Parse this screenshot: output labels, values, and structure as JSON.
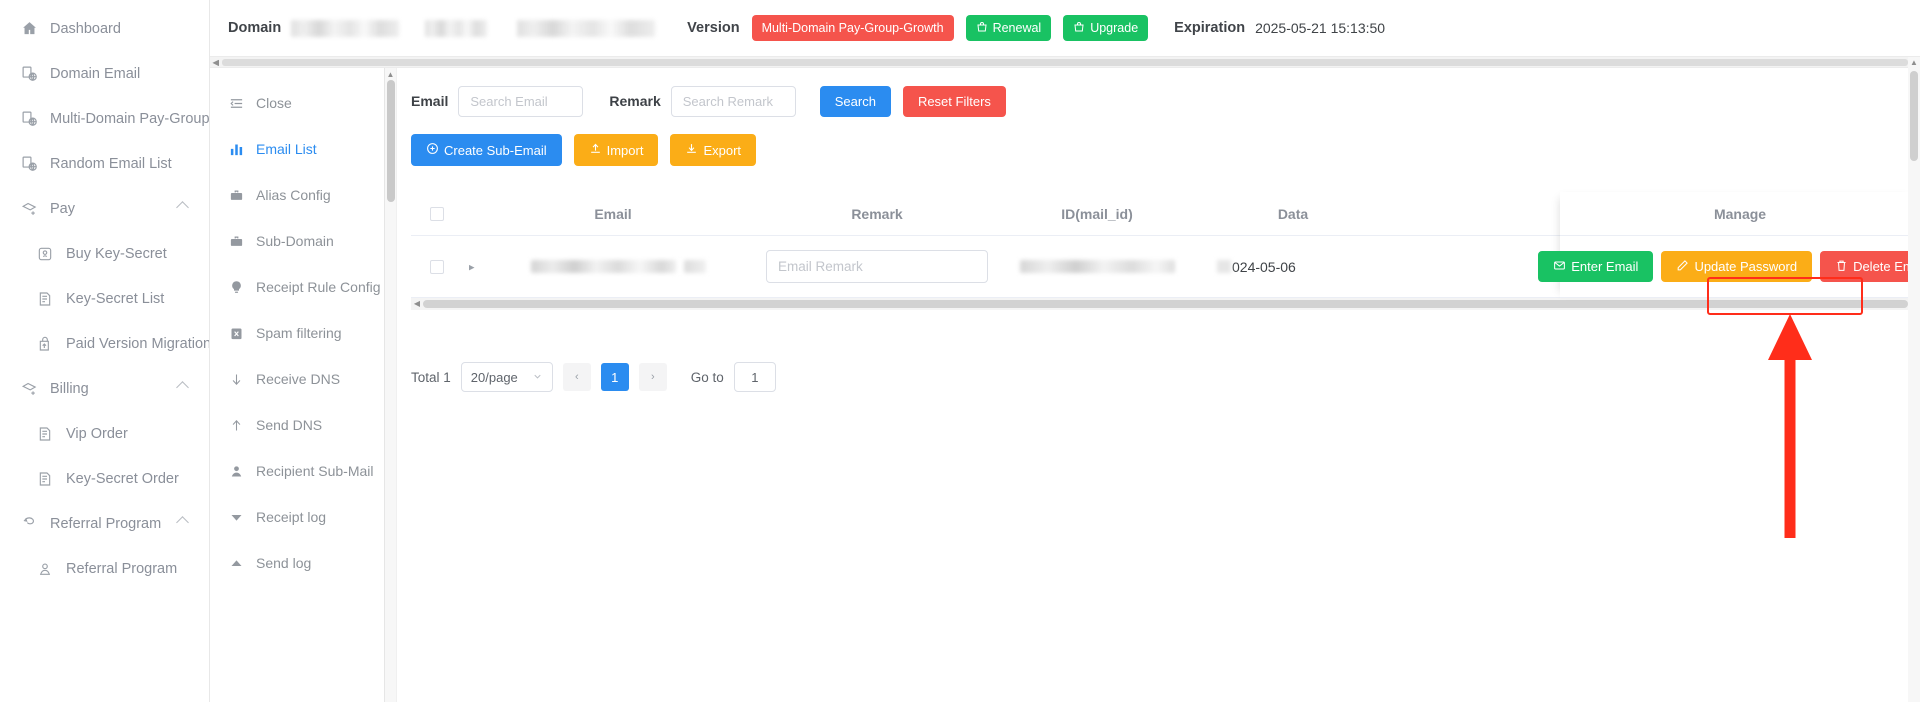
{
  "sidebar": {
    "items": [
      {
        "label": "Dashboard",
        "icon": "home-icon",
        "level": 0,
        "caret": false
      },
      {
        "label": "Domain Email",
        "icon": "domain-email-icon",
        "level": 0,
        "caret": false
      },
      {
        "label": "Multi-Domain Pay-Group",
        "icon": "domain-email-icon",
        "level": 0,
        "caret": false
      },
      {
        "label": "Random Email List",
        "icon": "domain-email-icon",
        "level": 0,
        "caret": false
      },
      {
        "label": "Pay",
        "icon": "pay-icon",
        "level": 0,
        "caret": true
      },
      {
        "label": "Buy Key-Secret",
        "icon": "key-buy-icon",
        "level": 1,
        "caret": false
      },
      {
        "label": "Key-Secret List",
        "icon": "list-icon",
        "level": 1,
        "caret": false
      },
      {
        "label": "Paid Version Migration",
        "icon": "migration-icon",
        "level": 1,
        "caret": false
      },
      {
        "label": "Billing",
        "icon": "pay-icon",
        "level": 0,
        "caret": true
      },
      {
        "label": "Vip Order",
        "icon": "list-icon",
        "level": 1,
        "caret": false
      },
      {
        "label": "Key-Secret Order",
        "icon": "list-icon",
        "level": 1,
        "caret": false
      },
      {
        "label": "Referral Program",
        "icon": "referral-icon",
        "level": 0,
        "caret": true
      },
      {
        "label": "Referral Program",
        "icon": "referral-person-icon",
        "level": 1,
        "caret": false
      }
    ]
  },
  "header": {
    "domain_label": "Domain",
    "version_label": "Version",
    "version_value": "Multi-Domain Pay-Group-Growth",
    "renewal_label": "Renewal",
    "upgrade_label": "Upgrade",
    "expiration_label": "Expiration",
    "expiration_value": "2025-05-21 15:13:50",
    "accent_red": "#f5544c",
    "accent_green": "#19c263"
  },
  "submenu": {
    "items": [
      {
        "label": "Close",
        "icon": "collapse-icon",
        "active": false
      },
      {
        "label": "Email List",
        "icon": "chart-bars-icon",
        "active": true
      },
      {
        "label": "Alias Config",
        "icon": "briefcase-icon",
        "active": false
      },
      {
        "label": "Sub-Domain",
        "icon": "briefcase-icon",
        "active": false
      },
      {
        "label": "Receipt Rule Config",
        "icon": "bulb-icon",
        "active": false
      },
      {
        "label": "Spam filtering",
        "icon": "spam-icon",
        "active": false
      },
      {
        "label": "Receive DNS",
        "icon": "arrow-down-icon",
        "active": false
      },
      {
        "label": "Send DNS",
        "icon": "arrow-up-icon",
        "active": false
      },
      {
        "label": "Recipient Sub-Mail",
        "icon": "person-icon",
        "active": false
      },
      {
        "label": "Receipt log",
        "icon": "triangle-down-icon",
        "active": false
      },
      {
        "label": "Send log",
        "icon": "triangle-up-icon",
        "active": false
      }
    ]
  },
  "filters": {
    "email_label": "Email",
    "email_placeholder": "Search Email",
    "email_value": "",
    "remark_label": "Remark",
    "remark_placeholder": "Search Remark",
    "remark_value": "",
    "search_label": "Search",
    "reset_label": "Reset Filters"
  },
  "actions": {
    "create_label": "Create Sub-Email",
    "import_label": "Import",
    "export_label": "Export"
  },
  "table": {
    "columns": [
      "Email",
      "Remark",
      "ID(mail_id)",
      "Data",
      "Manage"
    ],
    "rows": [
      {
        "email": "",
        "remark_placeholder": "Email Remark",
        "remark_value": "",
        "mail_id": "",
        "data": "024-05-06"
      }
    ],
    "manage_buttons": {
      "enter_label": "Enter Email",
      "update_label": "Update Password",
      "delete_label": "Delete Email"
    }
  },
  "pagination": {
    "total_label": "Total 1",
    "page_size": "20/page",
    "prev": "‹",
    "next": "›",
    "current_page": "1",
    "goto_label": "Go to",
    "goto_value": "1"
  },
  "annotation": {
    "highlight_color": "#ff2d1a",
    "target": "Delete Email"
  }
}
